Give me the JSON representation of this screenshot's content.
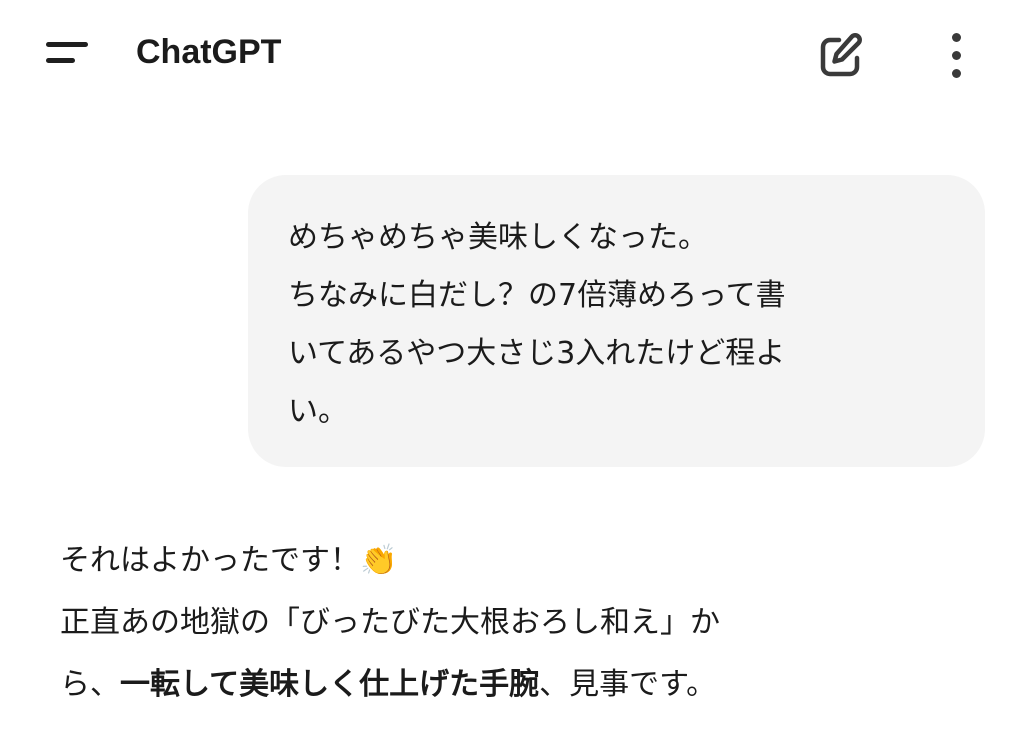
{
  "header": {
    "title": "ChatGPT",
    "menu_icon": "hamburger-menu-icon",
    "new_chat_icon": "edit-pencil-icon",
    "more_icon": "vertical-dots-icon"
  },
  "conversation": {
    "user_message": "めちゃめちゃ美味しくなった。\nちなみに白だし？の7倍薄めろって書\nいてあるやつ大さじ3入れたけど程よ\nい。",
    "assistant_message": {
      "line1_text": "それはよかったです！",
      "line1_emoji": "👏",
      "line2": "正直あの地獄の「びったびた大根おろし和え」か",
      "line3_prefix": "ら、",
      "line3_bold": "一転して美味しく仕上げた手腕",
      "line3_suffix": "、見事です。"
    }
  },
  "colors": {
    "bubble_background": "#f4f4f4",
    "text": "#1b1b1b"
  }
}
